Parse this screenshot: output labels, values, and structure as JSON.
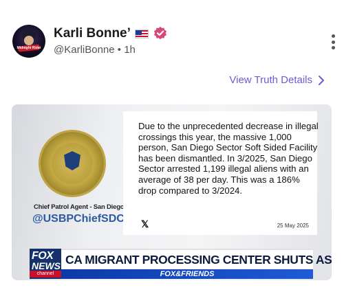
{
  "post": {
    "display_name": "Karli Bonne’",
    "handle": "@KarliBonne",
    "separator": "•",
    "time": "1h",
    "flag_icon": "us-flag-icon",
    "verified_icon": "verified-badge-icon",
    "verified_color": "#d9467a",
    "avatar_text": "Midnight Rider"
  },
  "details_link": {
    "label": "View Truth Details",
    "color": "#6b5bd6"
  },
  "media": {
    "agent_title": "Chief Patrol Agent - San Diego Sector",
    "agent_handle": "@USBPChiefSDC",
    "tweet_text": "Due to the unprecedented decrease in illegal crossings this year, the massive 1,000 person, San Diego Sector Soft Sided Facility has been dismantled. In 3/2025, San Diego Sector arrested 1,199 illegal aliens with an average of 38 per day. This was a 186% drop compared to 3/2024.",
    "tweet_logo": "𝕏",
    "tweet_date": "25 May 2025",
    "network_line1": "FOX",
    "network_line2": "NEWS",
    "network_line3": "channel",
    "headline": "CA MIGRANT PROCESSING CENTER SHUTS AS ARRESTS SINK",
    "show_name": "FOX&FRIENDS"
  }
}
